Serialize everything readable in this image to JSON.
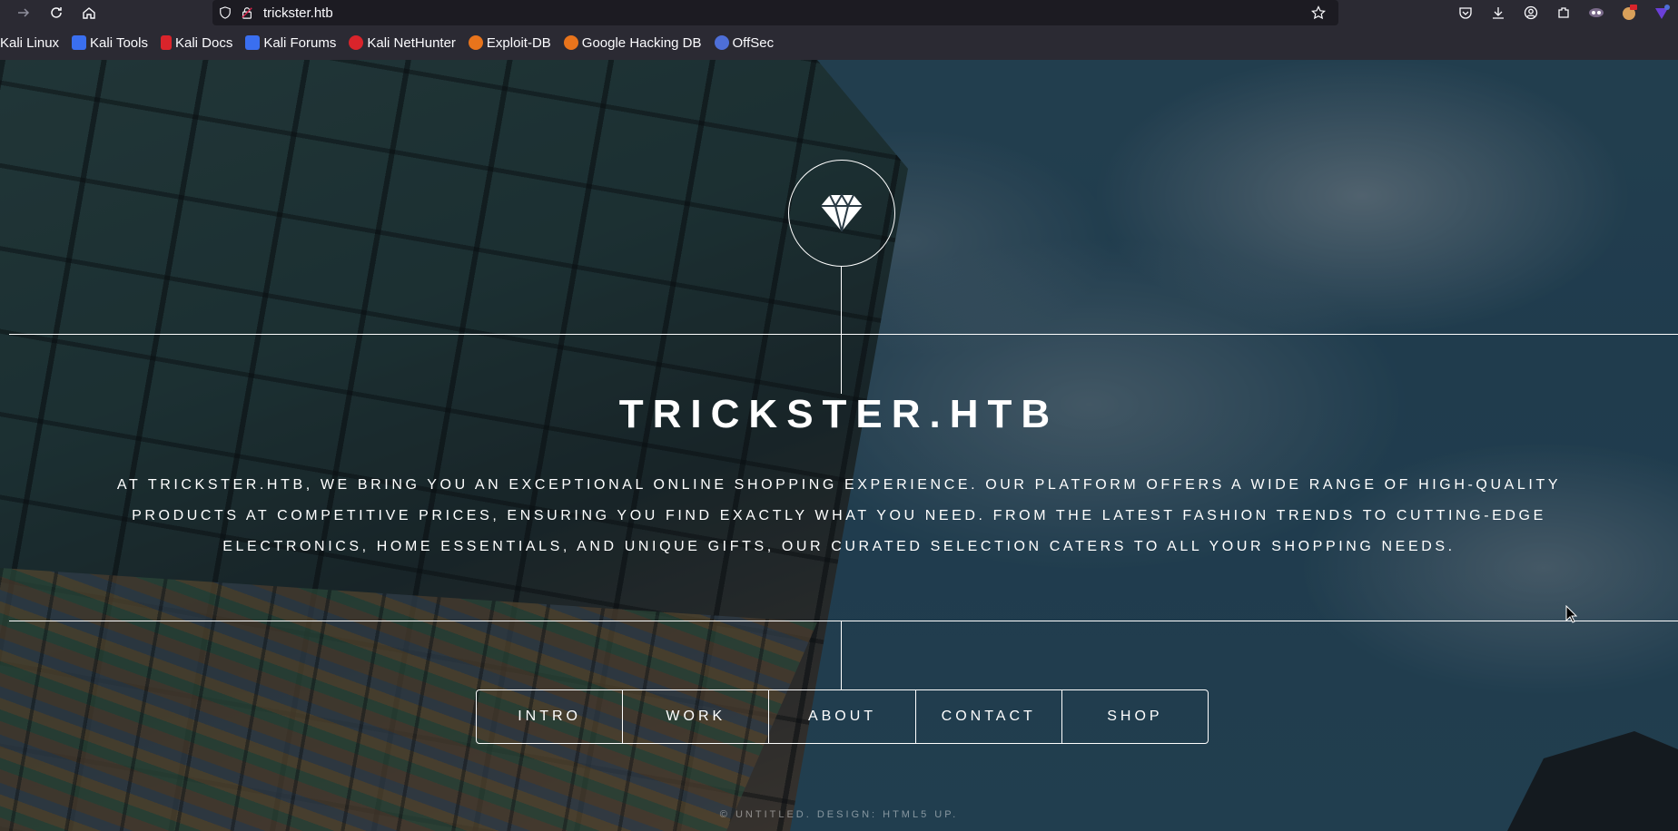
{
  "browser": {
    "url": "trickster.htb",
    "bookmarks": [
      {
        "label": "Kali Linux",
        "icon": "kali-icon"
      },
      {
        "label": "Kali Tools",
        "icon": "kali-tools-icon",
        "color": "#3a6ff0"
      },
      {
        "label": "Kali Docs",
        "icon": "kali-docs-icon",
        "color": "#d9242b"
      },
      {
        "label": "Kali Forums",
        "icon": "kali-forums-icon",
        "color": "#3a6ff0"
      },
      {
        "label": "Kali NetHunter",
        "icon": "kali-nethunter-icon",
        "color": "#d9242b"
      },
      {
        "label": "Exploit-DB",
        "icon": "exploit-db-icon",
        "color": "#e8741c"
      },
      {
        "label": "Google Hacking DB",
        "icon": "ghdb-icon",
        "color": "#e8741c"
      },
      {
        "label": "OffSec",
        "icon": "offsec-icon",
        "color": "#4e6fd8"
      }
    ]
  },
  "hero": {
    "title": "TRICKSTER.HTB",
    "description": "At trickster.htb, we bring you an exceptional online shopping experience. Our platform offers a wide range of high-quality products at competitive prices, ensuring you find exactly what you need. From the latest fashion trends to cutting-edge electronics, home essentials, and unique gifts, our curated selection caters to all your shopping needs.",
    "logo_icon": "diamond-icon"
  },
  "nav": {
    "items": [
      "INTRO",
      "WORK",
      "ABOUT",
      "CONTACT",
      "SHOP"
    ]
  },
  "footer": {
    "text": "© UNTITLED. DESIGN: HTML5 UP."
  }
}
